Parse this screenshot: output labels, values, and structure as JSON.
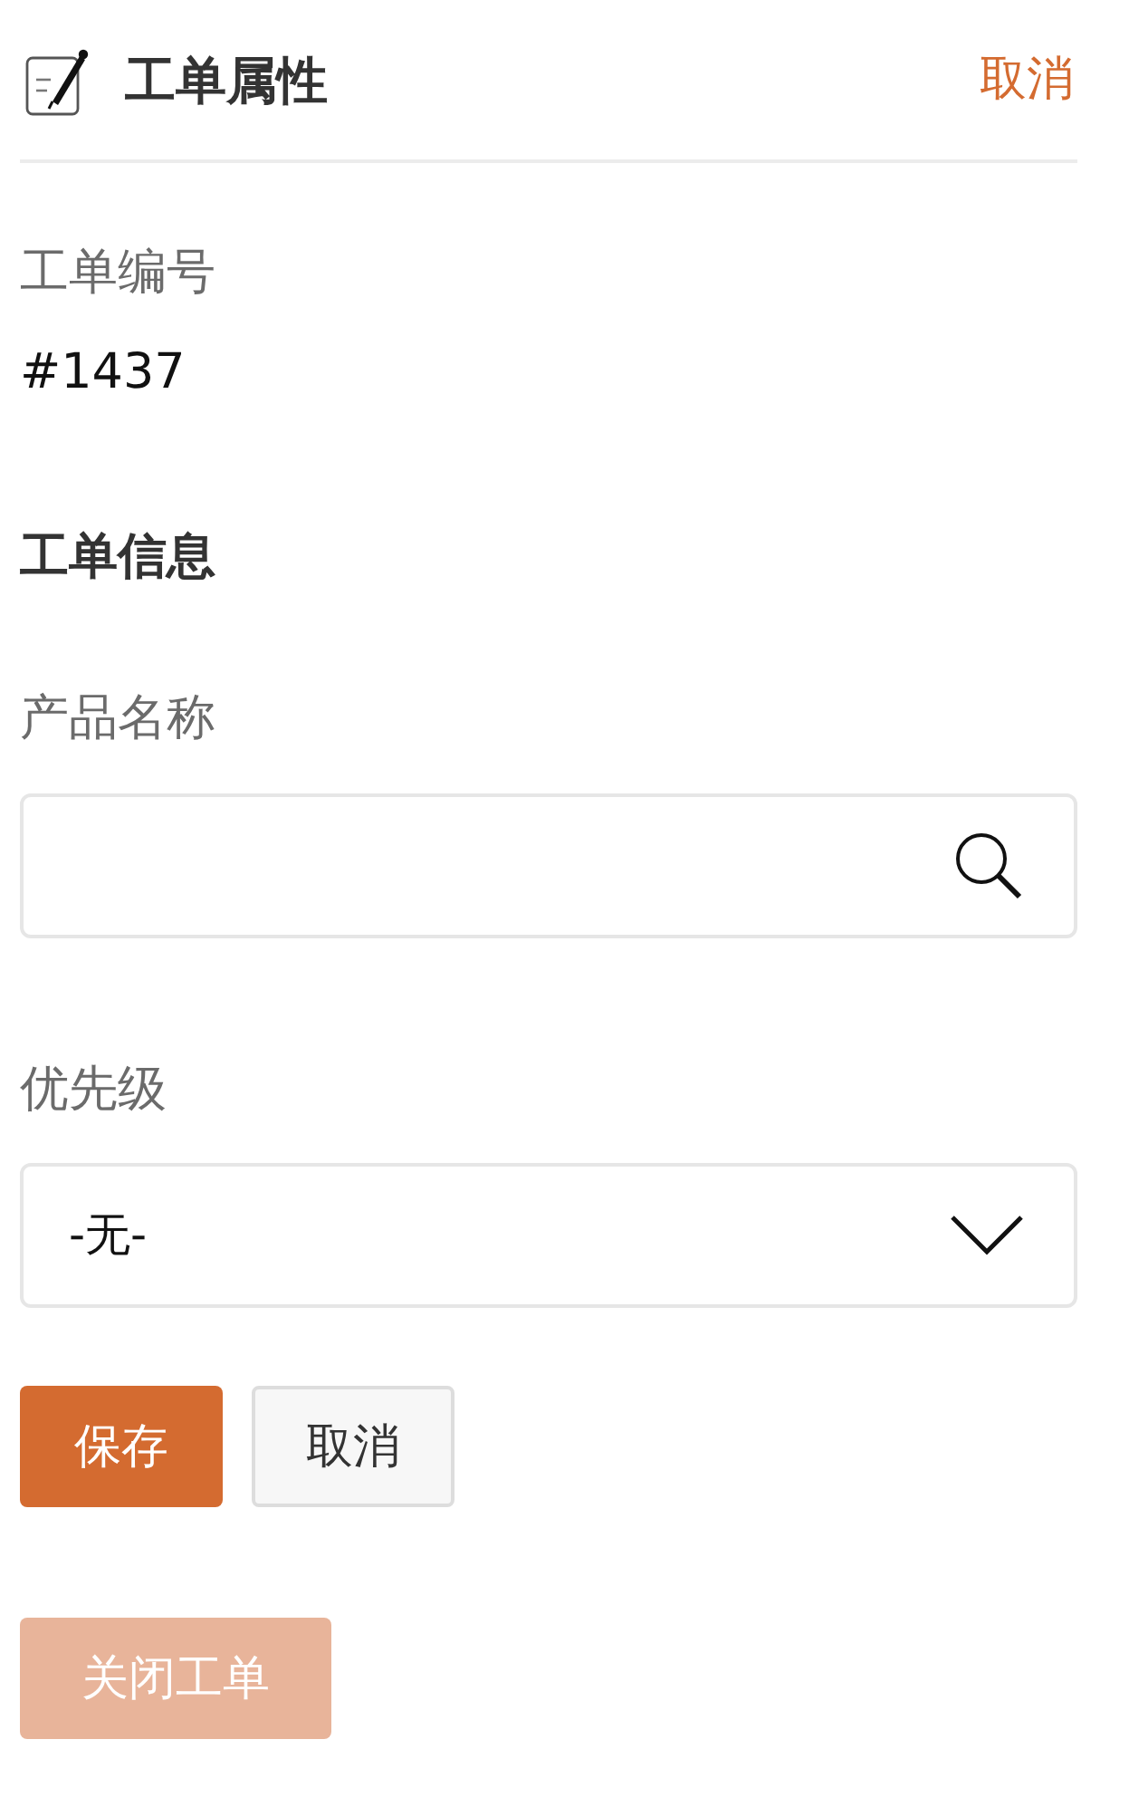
{
  "header": {
    "title": "工单属性",
    "cancel": "取消"
  },
  "ticket_number": {
    "label": "工单编号",
    "value": "#1437"
  },
  "section_title": "工单信息",
  "fields": [
    {
      "kind": "search",
      "label": "产品名称"
    },
    {
      "kind": "select",
      "label": "优先级",
      "value": "-无-"
    }
  ],
  "buttons": [
    {
      "label": "保存",
      "kind": "primary"
    },
    {
      "label": "取消",
      "kind": "secondary"
    }
  ],
  "close_button": {
    "label": "关闭工单",
    "disabled": true
  }
}
